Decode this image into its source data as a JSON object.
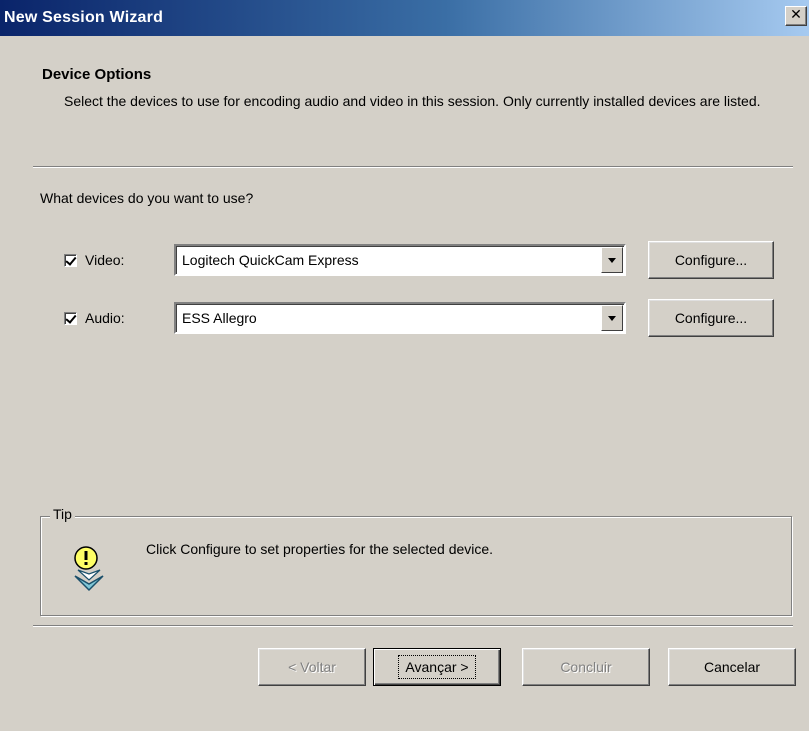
{
  "window": {
    "title": "New Session Wizard",
    "close_glyph": "✕"
  },
  "header": {
    "heading": "Device Options",
    "description": "Select the devices to use for encoding audio and video in this session. Only currently installed devices are listed."
  },
  "main": {
    "question": "What devices do you want to use?",
    "video": {
      "checked": true,
      "label": "Video:",
      "device": "Logitech QuickCam Express",
      "configure_label": "Configure..."
    },
    "audio": {
      "checked": true,
      "label": "Audio:",
      "device": "ESS Allegro",
      "configure_label": "Configure..."
    }
  },
  "tip": {
    "legend": "Tip",
    "text": "Click Configure to set properties for the selected device.",
    "icon": "lightbulb-tip-icon"
  },
  "footer": {
    "back_label": "< Voltar",
    "next_label": "Avançar >",
    "finish_label": "Concluir",
    "cancel_label": "Cancelar",
    "back_enabled": false,
    "finish_enabled": false
  },
  "colors": {
    "title_start": "#0a246a",
    "title_end": "#a6caf0",
    "face": "#d4d0c8"
  }
}
